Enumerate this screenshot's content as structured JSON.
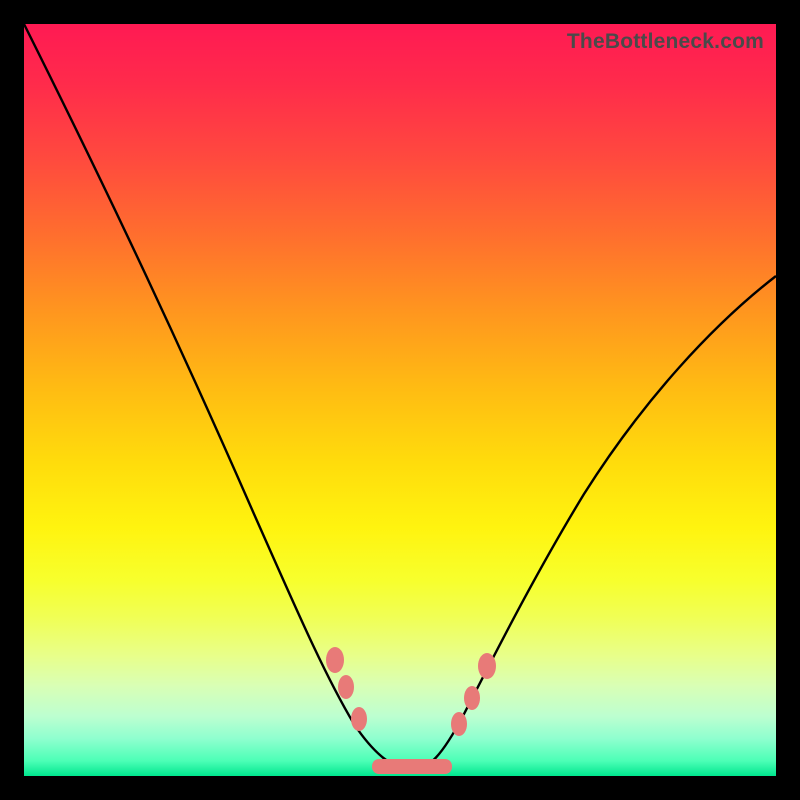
{
  "watermark": "TheBottleneck.com",
  "chart_data": {
    "type": "line",
    "title": "",
    "xlabel": "",
    "ylabel": "",
    "xlim": [
      0,
      100
    ],
    "ylim": [
      0,
      100
    ],
    "grid": false,
    "legend": false,
    "series": [
      {
        "name": "bottleneck-curve",
        "x": [
          0,
          5,
          10,
          15,
          20,
          25,
          30,
          35,
          40,
          42,
          45,
          48,
          50,
          52,
          54,
          56,
          60,
          65,
          70,
          75,
          80,
          85,
          90,
          95,
          100
        ],
        "y": [
          100,
          90,
          80,
          70,
          60,
          50,
          40,
          30,
          20,
          15,
          8,
          3,
          1,
          1,
          3,
          7,
          15,
          25,
          34,
          42,
          49,
          55,
          60,
          64,
          67
        ]
      }
    ],
    "markers": [
      {
        "shape": "ellipse",
        "x": 41.5,
        "y": 15,
        "label": "left-upper-dot"
      },
      {
        "shape": "ellipse",
        "x": 43.5,
        "y": 10,
        "label": "left-lower-dot"
      },
      {
        "shape": "bar",
        "x": 50,
        "y": 1,
        "label": "bottom-flat-bar"
      },
      {
        "shape": "ellipse",
        "x": 56,
        "y": 9,
        "label": "right-lower-dot"
      },
      {
        "shape": "ellipse",
        "x": 58.5,
        "y": 15,
        "label": "right-upper-dot"
      }
    ],
    "colors": {
      "curve": "#000000",
      "marker": "#e87a78",
      "gradient_top": "#ff1a53",
      "gradient_bottom": "#00e68e"
    }
  }
}
